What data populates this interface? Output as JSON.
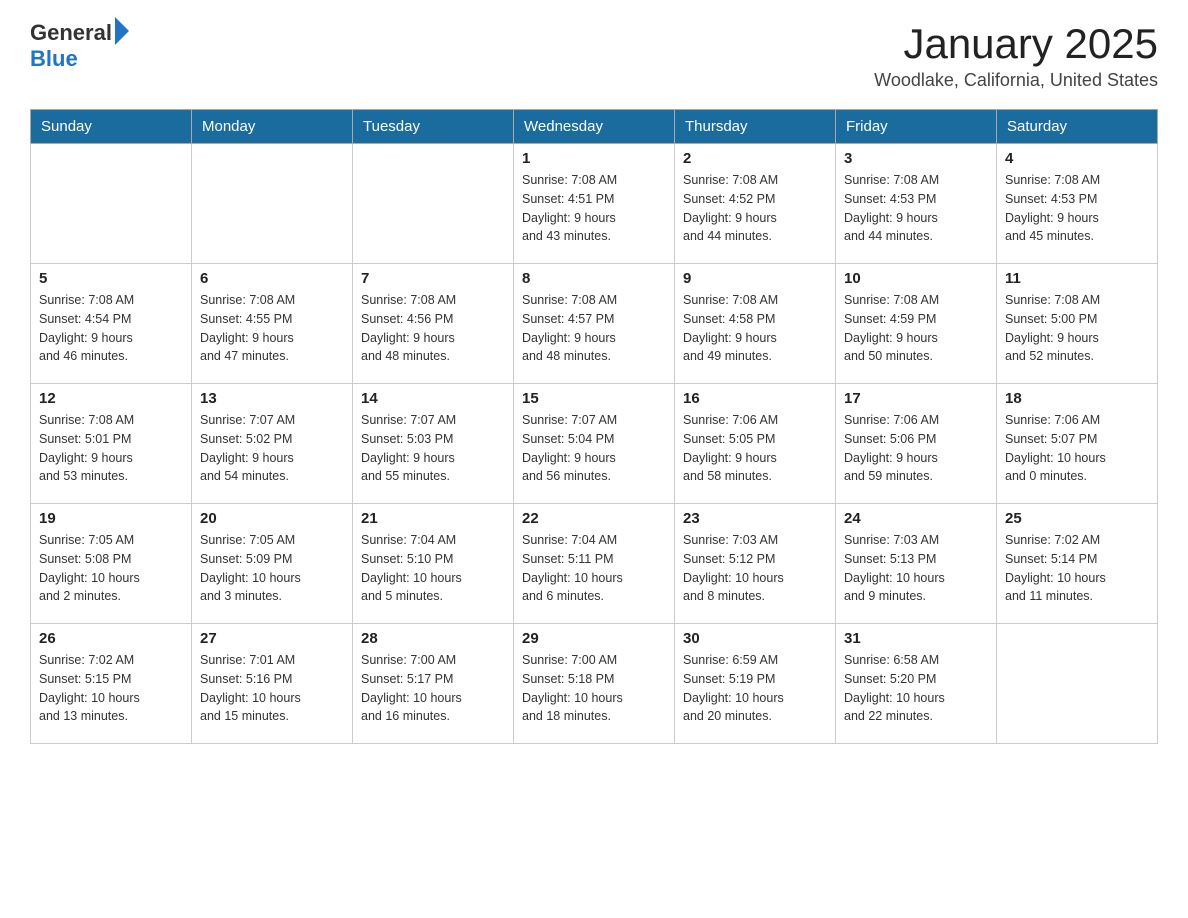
{
  "header": {
    "logo_general": "General",
    "logo_blue": "Blue",
    "title": "January 2025",
    "subtitle": "Woodlake, California, United States"
  },
  "days_of_week": [
    "Sunday",
    "Monday",
    "Tuesday",
    "Wednesday",
    "Thursday",
    "Friday",
    "Saturday"
  ],
  "weeks": [
    [
      {
        "day": "",
        "info": ""
      },
      {
        "day": "",
        "info": ""
      },
      {
        "day": "",
        "info": ""
      },
      {
        "day": "1",
        "info": "Sunrise: 7:08 AM\nSunset: 4:51 PM\nDaylight: 9 hours\nand 43 minutes."
      },
      {
        "day": "2",
        "info": "Sunrise: 7:08 AM\nSunset: 4:52 PM\nDaylight: 9 hours\nand 44 minutes."
      },
      {
        "day": "3",
        "info": "Sunrise: 7:08 AM\nSunset: 4:53 PM\nDaylight: 9 hours\nand 44 minutes."
      },
      {
        "day": "4",
        "info": "Sunrise: 7:08 AM\nSunset: 4:53 PM\nDaylight: 9 hours\nand 45 minutes."
      }
    ],
    [
      {
        "day": "5",
        "info": "Sunrise: 7:08 AM\nSunset: 4:54 PM\nDaylight: 9 hours\nand 46 minutes."
      },
      {
        "day": "6",
        "info": "Sunrise: 7:08 AM\nSunset: 4:55 PM\nDaylight: 9 hours\nand 47 minutes."
      },
      {
        "day": "7",
        "info": "Sunrise: 7:08 AM\nSunset: 4:56 PM\nDaylight: 9 hours\nand 48 minutes."
      },
      {
        "day": "8",
        "info": "Sunrise: 7:08 AM\nSunset: 4:57 PM\nDaylight: 9 hours\nand 48 minutes."
      },
      {
        "day": "9",
        "info": "Sunrise: 7:08 AM\nSunset: 4:58 PM\nDaylight: 9 hours\nand 49 minutes."
      },
      {
        "day": "10",
        "info": "Sunrise: 7:08 AM\nSunset: 4:59 PM\nDaylight: 9 hours\nand 50 minutes."
      },
      {
        "day": "11",
        "info": "Sunrise: 7:08 AM\nSunset: 5:00 PM\nDaylight: 9 hours\nand 52 minutes."
      }
    ],
    [
      {
        "day": "12",
        "info": "Sunrise: 7:08 AM\nSunset: 5:01 PM\nDaylight: 9 hours\nand 53 minutes."
      },
      {
        "day": "13",
        "info": "Sunrise: 7:07 AM\nSunset: 5:02 PM\nDaylight: 9 hours\nand 54 minutes."
      },
      {
        "day": "14",
        "info": "Sunrise: 7:07 AM\nSunset: 5:03 PM\nDaylight: 9 hours\nand 55 minutes."
      },
      {
        "day": "15",
        "info": "Sunrise: 7:07 AM\nSunset: 5:04 PM\nDaylight: 9 hours\nand 56 minutes."
      },
      {
        "day": "16",
        "info": "Sunrise: 7:06 AM\nSunset: 5:05 PM\nDaylight: 9 hours\nand 58 minutes."
      },
      {
        "day": "17",
        "info": "Sunrise: 7:06 AM\nSunset: 5:06 PM\nDaylight: 9 hours\nand 59 minutes."
      },
      {
        "day": "18",
        "info": "Sunrise: 7:06 AM\nSunset: 5:07 PM\nDaylight: 10 hours\nand 0 minutes."
      }
    ],
    [
      {
        "day": "19",
        "info": "Sunrise: 7:05 AM\nSunset: 5:08 PM\nDaylight: 10 hours\nand 2 minutes."
      },
      {
        "day": "20",
        "info": "Sunrise: 7:05 AM\nSunset: 5:09 PM\nDaylight: 10 hours\nand 3 minutes."
      },
      {
        "day": "21",
        "info": "Sunrise: 7:04 AM\nSunset: 5:10 PM\nDaylight: 10 hours\nand 5 minutes."
      },
      {
        "day": "22",
        "info": "Sunrise: 7:04 AM\nSunset: 5:11 PM\nDaylight: 10 hours\nand 6 minutes."
      },
      {
        "day": "23",
        "info": "Sunrise: 7:03 AM\nSunset: 5:12 PM\nDaylight: 10 hours\nand 8 minutes."
      },
      {
        "day": "24",
        "info": "Sunrise: 7:03 AM\nSunset: 5:13 PM\nDaylight: 10 hours\nand 9 minutes."
      },
      {
        "day": "25",
        "info": "Sunrise: 7:02 AM\nSunset: 5:14 PM\nDaylight: 10 hours\nand 11 minutes."
      }
    ],
    [
      {
        "day": "26",
        "info": "Sunrise: 7:02 AM\nSunset: 5:15 PM\nDaylight: 10 hours\nand 13 minutes."
      },
      {
        "day": "27",
        "info": "Sunrise: 7:01 AM\nSunset: 5:16 PM\nDaylight: 10 hours\nand 15 minutes."
      },
      {
        "day": "28",
        "info": "Sunrise: 7:00 AM\nSunset: 5:17 PM\nDaylight: 10 hours\nand 16 minutes."
      },
      {
        "day": "29",
        "info": "Sunrise: 7:00 AM\nSunset: 5:18 PM\nDaylight: 10 hours\nand 18 minutes."
      },
      {
        "day": "30",
        "info": "Sunrise: 6:59 AM\nSunset: 5:19 PM\nDaylight: 10 hours\nand 20 minutes."
      },
      {
        "day": "31",
        "info": "Sunrise: 6:58 AM\nSunset: 5:20 PM\nDaylight: 10 hours\nand 22 minutes."
      },
      {
        "day": "",
        "info": ""
      }
    ]
  ]
}
